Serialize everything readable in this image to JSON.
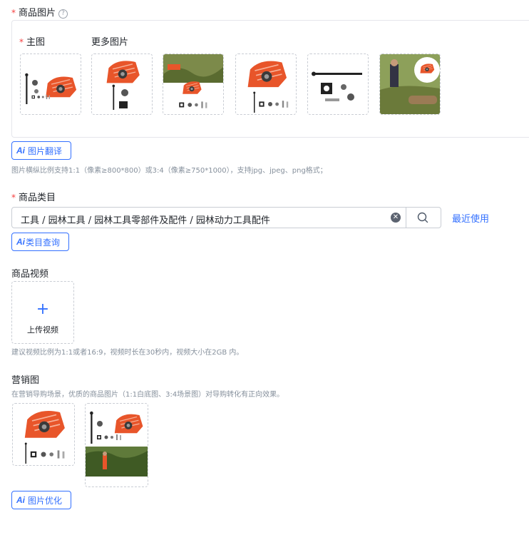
{
  "product_images": {
    "label": "商品图片",
    "help": "?",
    "main_label": "主图",
    "more_label": "更多图片",
    "thumbnails": [
      "part-kit-1",
      "part-kit-2",
      "forest-scene",
      "guard-kit",
      "bolt-kit",
      "worker-scene"
    ],
    "translate_button": "图片翻译",
    "hint": "图片横纵比例支持1:1（像素≥800*800）或3:4（像素≥750*1000），支持jpg、jpeg、png格式；"
  },
  "category": {
    "label": "商品类目",
    "value": "工具 / 园林工具 / 园林工具零部件及配件 / 园林动力工具配件",
    "recent_link": "最近使用",
    "query_button": "类目查询"
  },
  "video": {
    "label": "商品视频",
    "upload_label": "上传视频",
    "hint": "建议视频比例为1:1或者16:9，视频时长在30秒内，视频大小在2GB 内。"
  },
  "marketing": {
    "label": "营销图",
    "hint": "在营销导购场景，优质的商品图片（1:1白底图、3:4场景图）对导购转化有正向效果。",
    "optimize_button": "图片优化"
  },
  "ai_mark": "Ai",
  "colors": {
    "accent": "#3370ff",
    "required": "#f53f3f",
    "product_orange": "#e8552a"
  }
}
